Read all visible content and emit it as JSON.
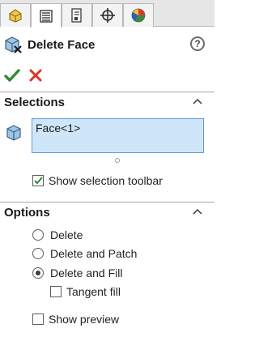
{
  "tabs": [
    {
      "icon": "feature-manager-icon",
      "active": false
    },
    {
      "icon": "property-manager-icon",
      "active": true
    },
    {
      "icon": "configuration-manager-icon",
      "active": false
    },
    {
      "icon": "dimxpert-manager-icon",
      "active": false
    },
    {
      "icon": "display-manager-icon",
      "active": false
    }
  ],
  "header": {
    "title": "Delete Face",
    "help_glyph": "?"
  },
  "actions": {
    "ok_icon": "checkmark-icon",
    "cancel_icon": "x-icon"
  },
  "selections": {
    "header": "Selections",
    "field_value": "Face<1>",
    "show_toolbar_label": "Show selection toolbar",
    "show_toolbar_checked": true
  },
  "options": {
    "header": "Options",
    "radios": [
      {
        "label": "Delete",
        "selected": false
      },
      {
        "label": "Delete and Patch",
        "selected": false
      },
      {
        "label": "Delete and Fill",
        "selected": true
      }
    ],
    "tangent_fill_label": "Tangent fill",
    "tangent_fill_checked": false,
    "show_preview_label": "Show preview",
    "show_preview_checked": false
  },
  "colors": {
    "ok_green": "#2e8b2e",
    "cancel_red": "#d9342b",
    "selection_fill": "#cfe6f9",
    "selection_border": "#5a9be0"
  }
}
